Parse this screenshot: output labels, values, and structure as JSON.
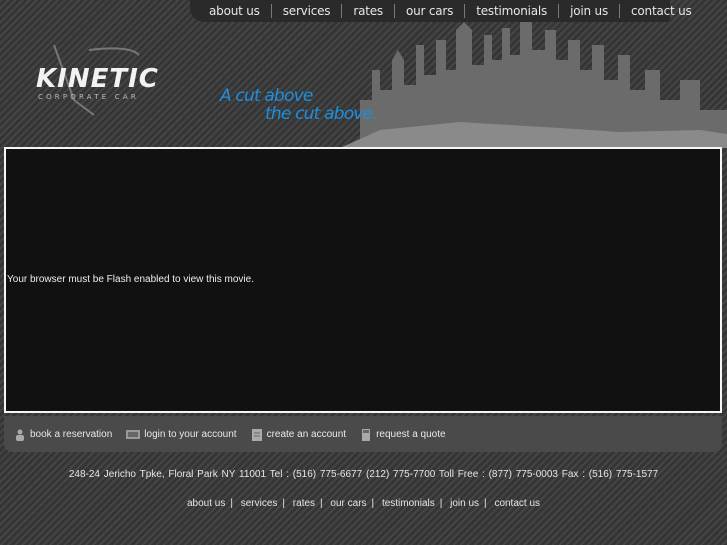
{
  "nav": {
    "items": [
      "about us",
      "services",
      "rates",
      "our cars",
      "testimonials",
      "join us",
      "contact us"
    ]
  },
  "logo": {
    "title": "KINETIC",
    "subtitle": "CORPORATE CAR"
  },
  "tagline": {
    "line1": "A cut above",
    "line2": "the cut above."
  },
  "movie": {
    "message": "Your browser must be Flash enabled to view this movie."
  },
  "actions": [
    {
      "label": "book a reservation",
      "icon": "person-icon"
    },
    {
      "label": "login to your account",
      "icon": "monitor-icon"
    },
    {
      "label": "create an account",
      "icon": "document-icon"
    },
    {
      "label": "request a quote",
      "icon": "calculator-icon"
    }
  ],
  "footer": {
    "address": "248-24 Jericho Tpke, Floral Park NY 11001  Tel : (516) 775-6677   (212) 775-7700  Toll Free : (877) 775-0003   Fax : (516) 775-1577",
    "links": [
      "about us",
      "services",
      "rates",
      "our cars",
      "testimonials",
      "join us",
      "contact us"
    ]
  },
  "colors": {
    "accent": "#1e8fe0",
    "background": "#3a3a3a",
    "movie_bg": "#111111"
  }
}
